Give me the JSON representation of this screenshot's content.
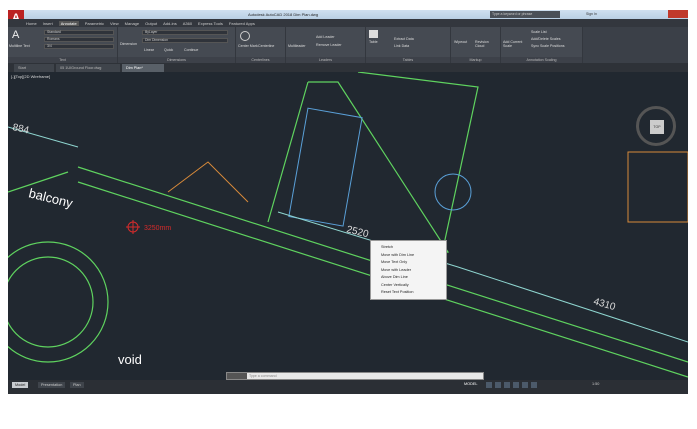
{
  "title": "Autodesk AutoCAD 2018  Dim Plan.dwg",
  "search_placeholder": "Type a keyword or phrase",
  "user": "Sign In",
  "menu": [
    "Home",
    "Insert",
    "Annotate",
    "Parametric",
    "View",
    "Manage",
    "Output",
    "Add-ins",
    "A360",
    "Express Tools",
    "Featured Apps"
  ],
  "active_menu": "Annotate",
  "ribbon": {
    "text": {
      "title": "Text",
      "multiline": "Multiline Text",
      "style": "Standard",
      "font": "Romans",
      "height": "3/4"
    },
    "dimensions": {
      "title": "Dimensions",
      "dimension": "Dimension",
      "layer": "Dim Dimension",
      "style": "ByLayer",
      "linear": "Linear",
      "quick": "Quick",
      "continue": "Continue"
    },
    "centerlines": {
      "title": "Centerlines",
      "center_mark": "Center Mark",
      "centerline": "Centerline"
    },
    "leaders": {
      "title": "Leaders",
      "multileader": "Multileader",
      "add": "Add Leader",
      "remove": "Remove Leader"
    },
    "tables": {
      "title": "Tables",
      "table": "Table",
      "extract": "Extract Data",
      "link": "Link Data"
    },
    "markup": {
      "title": "Markup",
      "wipeout": "Wipeout",
      "revision": "Revision Cloud"
    },
    "annotation_scaling": {
      "title": "Annotation Scaling",
      "add_scale": "Add Current Scale",
      "scale_list": "Scale List",
      "add_delete": "Add/Delete Scales",
      "sync": "Sync Scale Positions"
    }
  },
  "doc_tabs": [
    "Start",
    "05 1UIGround Floor.dwg",
    "Dim Plan*"
  ],
  "active_doc_tab": "Dim Plan*",
  "view_label": "[-][Top][2D Wireframe]",
  "drawing": {
    "dims": [
      "884",
      "2520",
      "4310"
    ],
    "labels": [
      "balcony",
      "void"
    ],
    "radius": "3250mm",
    "cube": "TOP"
  },
  "context_menu": [
    "Stretch",
    "Move with Dim Line",
    "Move Text Only",
    "Move with Leader",
    "Above Dim Line",
    "Center Vertically",
    "Reset Text Position"
  ],
  "command_placeholder": "Type a command",
  "layout_tabs": [
    "Model",
    "Presentation",
    "Plan"
  ],
  "active_layout": "Model",
  "status": {
    "mode": "MODEL",
    "scale": "1:50"
  },
  "colors": {
    "canvas": "#212830",
    "ribbon": "#454a52",
    "walls": "#5fd35f",
    "dims": "#8fd6d0",
    "accent_red": "#d62b2b"
  }
}
